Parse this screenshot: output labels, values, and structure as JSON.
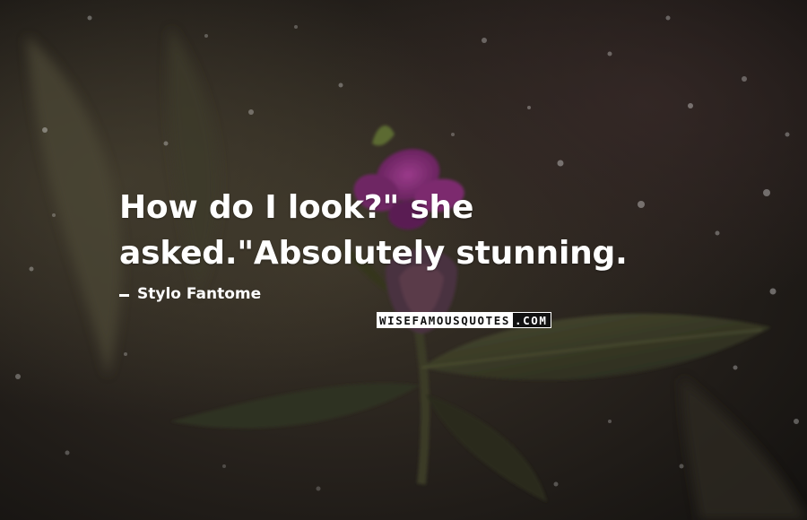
{
  "quote": {
    "line1": "How do I look?\" she",
    "line2": "asked.\"Absolutely stunning."
  },
  "author": {
    "name": "Stylo Fantome"
  },
  "watermark": {
    "brand": "WISEFAMOUSQUOTES",
    "suffix": ".COM"
  },
  "image": {
    "subject": "purple-flower-photo",
    "colors": {
      "background": "#1e1a17",
      "petal": "#7a2a6e",
      "leaf": "#3a3c26",
      "text": "#ffffff"
    }
  }
}
